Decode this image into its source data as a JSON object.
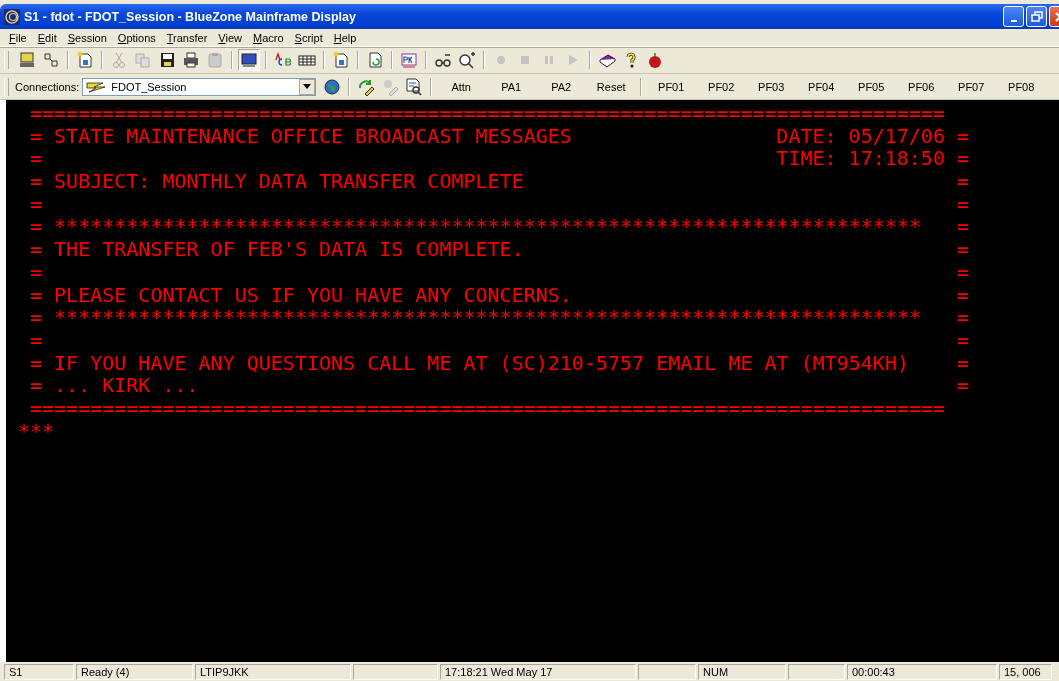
{
  "window": {
    "title": "S1 - fdot - FDOT_Session - BlueZone Mainframe Display"
  },
  "menu": [
    "File",
    "Edit",
    "Session",
    "Options",
    "Transfer",
    "View",
    "Macro",
    "Script",
    "Help"
  ],
  "connection_bar": {
    "label": "Connections:",
    "session": "FDOT_Session"
  },
  "key_buttons": [
    {
      "label": "Attn",
      "group_start": true
    },
    {
      "label": "PA1",
      "group_start": false
    },
    {
      "label": "PA2",
      "group_start": false
    },
    {
      "label": "Reset",
      "group_start": false
    },
    {
      "label": "PF01",
      "group_start": true
    },
    {
      "label": "PF02",
      "group_start": false
    },
    {
      "label": "PF03",
      "group_start": false
    },
    {
      "label": "PF04",
      "group_start": false
    },
    {
      "label": "PF05",
      "group_start": false
    },
    {
      "label": "PF06",
      "group_start": false
    },
    {
      "label": "PF07",
      "group_start": false
    },
    {
      "label": "PF08",
      "group_start": false
    }
  ],
  "terminal": {
    "rows": [
      {
        "text": "============================================================================",
        "end": ""
      },
      {
        "text": "= STATE MAINTENANCE OFFICE BROADCAST MESSAGES",
        "end": "DATE: 05/17/06 ="
      },
      {
        "text": "=",
        "end": "TIME: 17:18:50 ="
      },
      {
        "text": "= SUBJECT: MONTHLY DATA TRANSFER COMPLETE",
        "end": "="
      },
      {
        "text": "=",
        "end": "="
      },
      {
        "text": "= ************************************************************************",
        "end": "="
      },
      {
        "text": "= THE TRANSFER OF FEB'S DATA IS COMPLETE.",
        "end": "="
      },
      {
        "text": "=",
        "end": "="
      },
      {
        "text": "= PLEASE CONTACT US IF YOU HAVE ANY CONCERNS.",
        "end": "="
      },
      {
        "text": "= ************************************************************************",
        "end": "="
      },
      {
        "text": "=",
        "end": "="
      },
      {
        "text": "= IF YOU HAVE ANY QUESTIONS CALL ME AT (SC)210-5757 EMAIL ME AT (MT954KH)",
        "end": "="
      },
      {
        "text": "= ... KIRK ...",
        "end": "="
      },
      {
        "text": "============================================================================",
        "end": ""
      }
    ],
    "trailer": "***"
  },
  "status_bar": [
    "S1",
    "Ready (4)",
    "LTIP9JKK",
    "17:18:21  Wed May 17",
    "NUM",
    "00:00:43",
    "15, 006"
  ]
}
